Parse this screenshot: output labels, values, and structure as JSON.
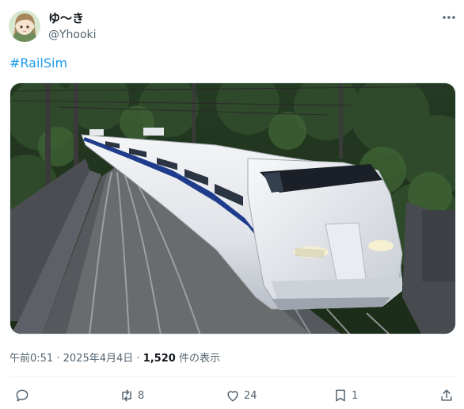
{
  "author": {
    "display_name": "ゆ〜き",
    "handle": "@Yhooki"
  },
  "post": {
    "hashtag": "#RailSim",
    "media_alt": "Shinkansen 300 series train in RailSim",
    "time": "午前0:51",
    "separator": "·",
    "date": "2025年4月4日",
    "views_count": "1,520",
    "views_suffix": " 件の表示"
  },
  "actions": {
    "reply": {
      "icon": "reply-icon",
      "count": ""
    },
    "retweet": {
      "icon": "retweet-icon",
      "count": "8"
    },
    "like": {
      "icon": "heart-icon",
      "count": "24"
    },
    "bookmark": {
      "icon": "bookmark-icon",
      "count": "1"
    },
    "share": {
      "icon": "share-icon",
      "count": ""
    }
  },
  "colors": {
    "accent": "#1d9bf0",
    "text": "#0f1419",
    "muted": "#536471"
  }
}
